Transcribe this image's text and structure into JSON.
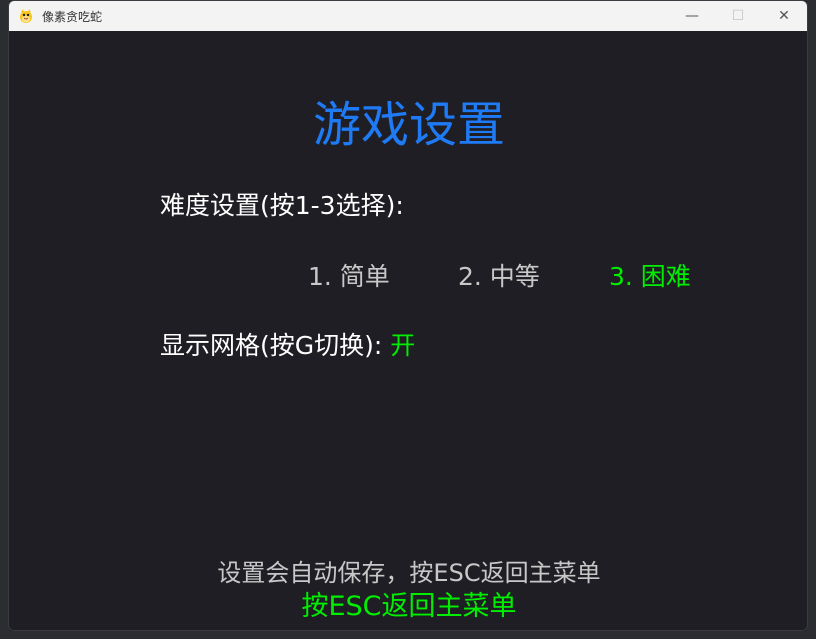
{
  "window": {
    "title": "像素贪吃蛇",
    "controls": {
      "minimize": "—",
      "maximize": "☐",
      "close": "✕"
    }
  },
  "settings": {
    "heading": "游戏设置",
    "difficulty_label": "难度设置(按1-3选择):",
    "difficulty_options": [
      {
        "label": "1. 简单",
        "selected": false
      },
      {
        "label": "2. 中等",
        "selected": false
      },
      {
        "label": "3. 困难",
        "selected": true
      }
    ],
    "grid_label": "显示网格(按G切换):",
    "grid_value": "开",
    "autosave_note": "设置会自动保存，按ESC返回主菜单",
    "esc_hint": "按ESC返回主菜单"
  },
  "colors": {
    "heading": "#1e7bf5",
    "selected": "#00ee00",
    "unselected": "#c8c8c8",
    "background": "#1f1e24"
  }
}
